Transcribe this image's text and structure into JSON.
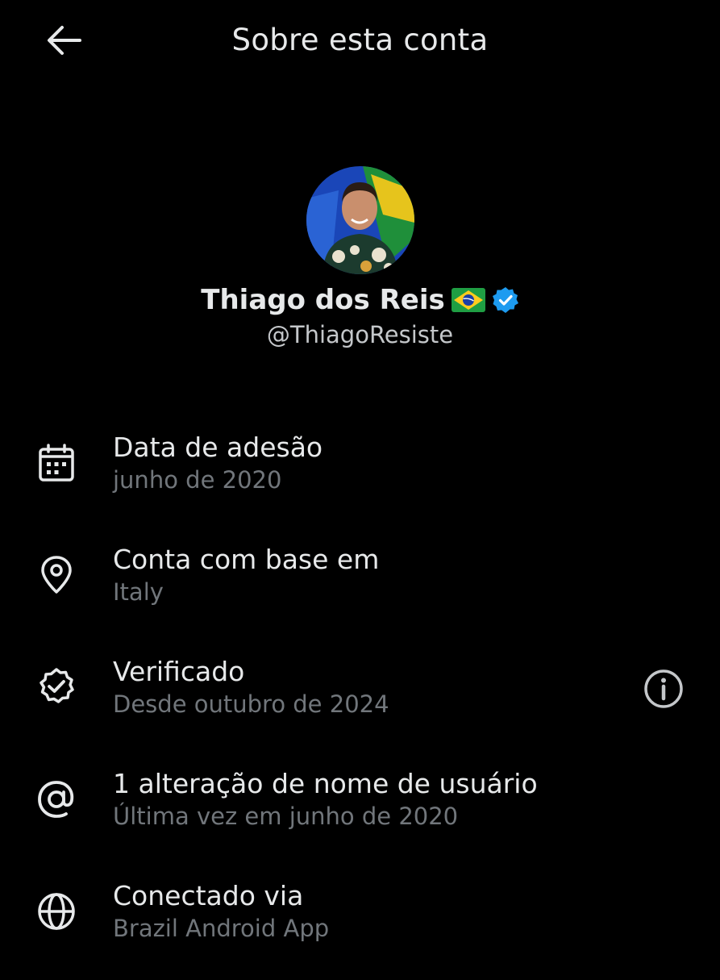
{
  "header": {
    "title": "Sobre esta conta",
    "back_icon": "arrow-left-icon"
  },
  "profile": {
    "display_name": "Thiago dos Reis",
    "flag": "🇧🇷",
    "handle": "@ThiagoResiste",
    "verified_color": "#1d9bf0"
  },
  "items": [
    {
      "icon": "calendar-icon",
      "label": "Data de adesão",
      "sub": "junho de 2020"
    },
    {
      "icon": "location-pin-icon",
      "label": "Conta com base em",
      "sub": "Italy"
    },
    {
      "icon": "verified-badge-icon",
      "label": "Verificado",
      "sub": "Desde outubro de 2024",
      "action_icon": "info-icon"
    },
    {
      "icon": "at-sign-icon",
      "label": "1 alteração de nome de usuário",
      "sub": "Última vez em junho de 2020"
    },
    {
      "icon": "globe-icon",
      "label": "Conectado via",
      "sub": "Brazil Android App"
    }
  ],
  "colors": {
    "background": "#000000",
    "primary_text": "#e7e9ea",
    "secondary_text": "#71767b"
  }
}
